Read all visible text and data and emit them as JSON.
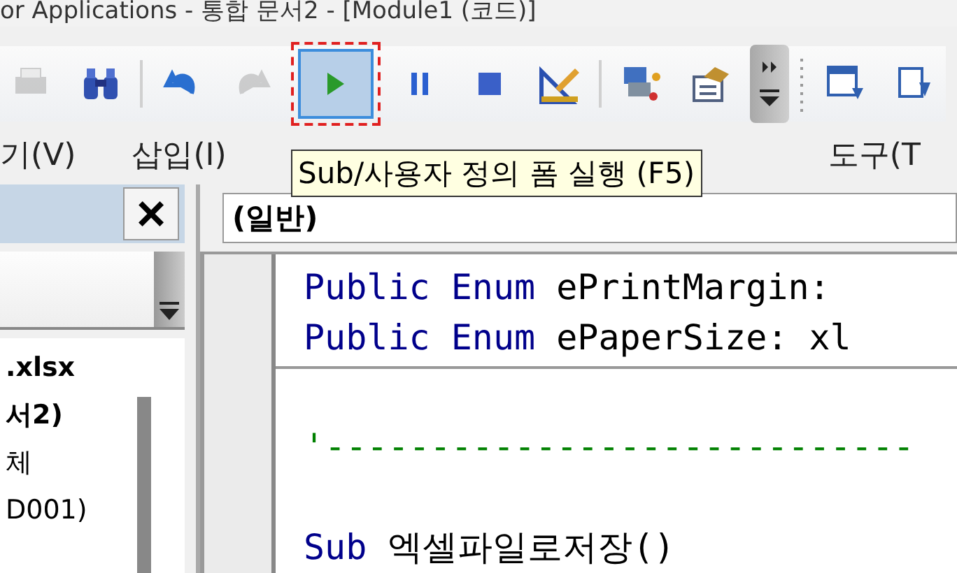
{
  "window": {
    "title": "or Applications - 통합 문서2 - [Module1 (코드)]"
  },
  "toolbar": {
    "buttons": [
      {
        "kind": "print",
        "disabled": true,
        "selected": false
      },
      {
        "kind": "find",
        "disabled": false,
        "selected": false
      },
      {
        "kind": "separator"
      },
      {
        "kind": "undo",
        "disabled": false,
        "selected": false
      },
      {
        "kind": "redo",
        "disabled": true,
        "selected": false
      },
      {
        "kind": "run",
        "disabled": false,
        "selected": true
      },
      {
        "kind": "pause",
        "disabled": false,
        "selected": false
      },
      {
        "kind": "stop",
        "disabled": false,
        "selected": false
      },
      {
        "kind": "design",
        "disabled": false,
        "selected": false
      },
      {
        "kind": "separator"
      },
      {
        "kind": "project",
        "disabled": false,
        "selected": false
      },
      {
        "kind": "properties",
        "disabled": false,
        "selected": false
      },
      {
        "kind": "overflow"
      },
      {
        "kind": "grip"
      },
      {
        "kind": "window",
        "disabled": false,
        "selected": false
      },
      {
        "kind": "import",
        "disabled": false,
        "selected": false
      }
    ]
  },
  "menu": [
    {
      "label": "기(V)"
    },
    {
      "label": "삽입(I)"
    },
    {
      "label": "도구(T"
    }
  ],
  "tooltip": {
    "text": "Sub/사용자 정의 폼 실행 (F5)"
  },
  "project_panel": {
    "close": "×",
    "tree": [
      {
        "label": ".xlsx",
        "bold": true
      },
      {
        "label": "서2)",
        "bold": true
      },
      {
        "label": "체",
        "bold": false
      },
      {
        "label": "D001)",
        "bold": false
      }
    ]
  },
  "code_window": {
    "object_combo": "(일반)",
    "lines": [
      {
        "kind": "code",
        "parts": [
          {
            "text": "Public Enum",
            "keyword": true
          },
          {
            "text": "ePrintMargin:",
            "keyword": false
          }
        ]
      },
      {
        "kind": "code",
        "parts": [
          {
            "text": "Public Enum",
            "keyword": true
          },
          {
            "text": "ePaperSize: xl",
            "keyword": false
          }
        ]
      },
      {
        "kind": "divider"
      },
      {
        "kind": "blank"
      },
      {
        "kind": "comment",
        "parts": [
          {
            "text": "'----------------------------",
            "keyword": false
          }
        ]
      },
      {
        "kind": "blank"
      },
      {
        "kind": "code",
        "parts": [
          {
            "text": "Sub",
            "keyword": true
          },
          {
            "text": "엑셀파일로저장()",
            "keyword": false
          }
        ]
      }
    ]
  }
}
